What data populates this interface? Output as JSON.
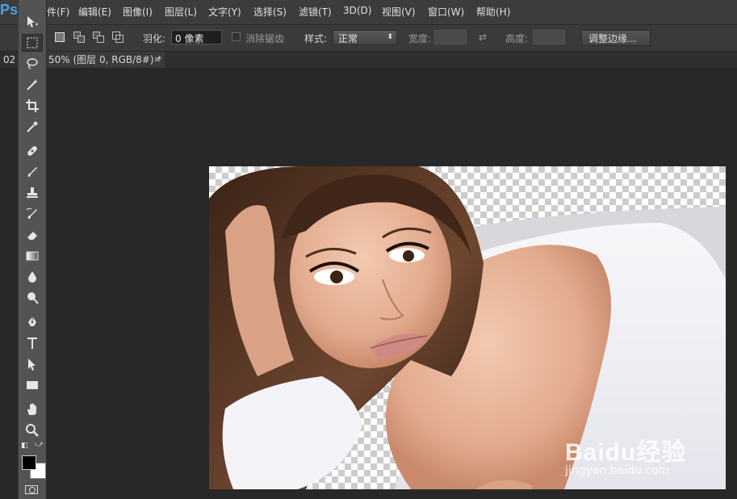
{
  "app": {
    "logo": "Ps"
  },
  "menu": [
    "件(F)",
    "编辑(E)",
    "图像(I)",
    "图层(L)",
    "文字(Y)",
    "选择(S)",
    "滤镜(T)",
    "3D(D)",
    "视图(V)",
    "窗口(W)",
    "帮助(H)"
  ],
  "options": {
    "feather_label": "羽化:",
    "feather_value": "0 像素",
    "antialias_label": "消除锯齿",
    "style_label": "样式:",
    "style_value": "正常",
    "width_label": "宽度:",
    "height_label": "高度:",
    "refine_edge_label": "调整边缘..."
  },
  "document": {
    "tab_prefix": "02",
    "tab_title": "50% (图层 0, RGB/8#) *",
    "close_glyph": "×"
  },
  "tools": [
    "move-tool",
    "marquee-tool",
    "lasso-tool",
    "magic-wand-tool",
    "crop-tool",
    "eyedropper-tool",
    "healing-brush-tool",
    "brush-tool",
    "clone-stamp-tool",
    "history-brush-tool",
    "eraser-tool",
    "gradient-tool",
    "blur-tool",
    "dodge-tool",
    "pen-tool",
    "type-tool",
    "path-selection-tool",
    "rectangle-tool",
    "hand-tool",
    "zoom-tool"
  ],
  "colors": {
    "foreground": "#000000",
    "background": "#ffffff",
    "accent": "#4aa3e6"
  },
  "watermark": {
    "brand": "Baidu经验",
    "url": "jingyan.baidu.com"
  }
}
